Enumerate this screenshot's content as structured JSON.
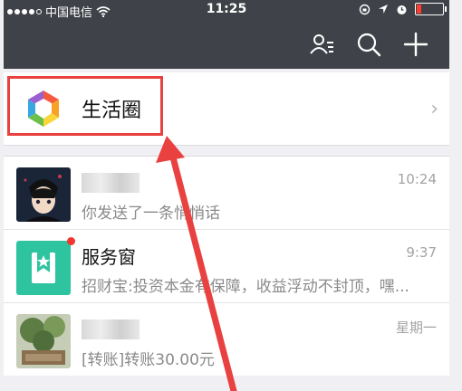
{
  "status_bar": {
    "carrier": "中国电信",
    "time": "11:25"
  },
  "header": {
    "icons": [
      "contacts-icon",
      "search-icon",
      "add-icon"
    ]
  },
  "life_circle": {
    "label": "生活圈",
    "chevron": "›"
  },
  "conversations": [
    {
      "name": "",
      "time": "10:24",
      "message": "你发送了一条悄悄话",
      "avatar": "anime-avatar"
    },
    {
      "name": "服务窗",
      "time": "9:37",
      "message": "招财宝:投资本金有保障，收益浮动不封顶，嘿...",
      "avatar": "service-window-icon",
      "unread_dot": true
    },
    {
      "name": "",
      "time": "星期一",
      "message": "[转账]转账30.00元",
      "avatar": "plant-photo-avatar"
    }
  ],
  "annotation": {
    "highlight_color": "#e94040"
  }
}
